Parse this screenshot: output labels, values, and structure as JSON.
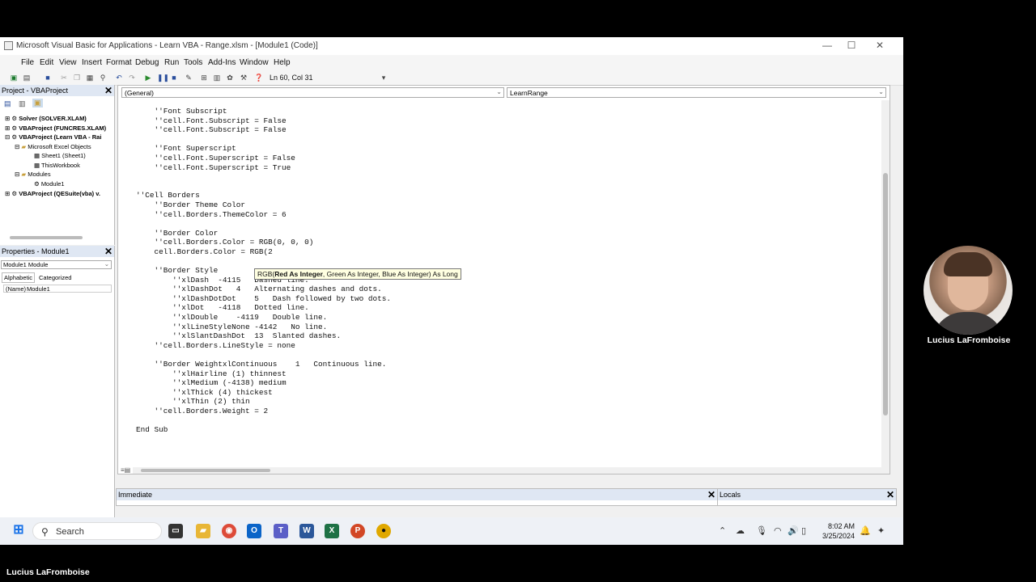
{
  "window": {
    "title": "Microsoft Visual Basic for Applications - Learn VBA - Range.xlsm - [Module1 (Code)]",
    "minimize": "—",
    "maximize": "☐",
    "close": "✕"
  },
  "menu": [
    "File",
    "Edit",
    "View",
    "Insert",
    "Format",
    "Debug",
    "Run",
    "Tools",
    "Add-Ins",
    "Window",
    "Help"
  ],
  "toolbar": {
    "position": "Ln 60, Col 31"
  },
  "project": {
    "title": "Project - VBAProject",
    "items": [
      {
        "label": "Solver (SOLVER.XLAM)",
        "bold": true
      },
      {
        "label": "VBAProject (FUNCRES.XLAM)",
        "bold": true
      },
      {
        "label": "VBAProject (Learn VBA - Rai",
        "bold": true
      },
      {
        "label": "Microsoft Excel Objects",
        "bold": false
      },
      {
        "label": "Sheet1 (Sheet1)",
        "bold": false
      },
      {
        "label": "ThisWorkbook",
        "bold": false
      },
      {
        "label": "Modules",
        "bold": false
      },
      {
        "label": "Module1",
        "bold": false
      },
      {
        "label": "VBAProject (QESuite(vba) v.",
        "bold": true
      }
    ]
  },
  "properties": {
    "title": "Properties - Module1",
    "object": "Module1 Module",
    "tabs": [
      "Alphabetic",
      "Categorized"
    ],
    "row_name": "(Name)",
    "row_value": "Module1"
  },
  "code_window": {
    "general": "(General)",
    "proc": "LearnRange",
    "code": "    ''Font Subscript\n    ''cell.Font.Subscript = False\n    ''cell.Font.Subscript = False\n\n    ''Font Superscript\n    ''cell.Font.Superscript = False\n    ''cell.Font.Superscript = True\n\n\n''Cell Borders\n    ''Border Theme Color\n    ''cell.Borders.ThemeColor = 6\n\n    ''Border Color\n    ''cell.Borders.Color = RGB(0, 0, 0)\n    cell.Borders.Color = RGB(2\n\n    ''Border Style\n        ''xlDash  -4115   Dashed line.\n        ''xlDashDot   4   Alternating dashes and dots.\n        ''xlDashDotDot    5   Dash followed by two dots.\n        ''xlDot   -4118   Dotted line.\n        ''xlDouble    -4119   Double line.\n        ''xlLineStyleNone -4142   No line.\n        ''xlSlantDashDot  13  Slanted dashes.\n    ''cell.Borders.LineStyle = none\n\n    ''Border WeightxlContinuous    1   Continuous line.\n        ''xlHairline (1) thinnest\n        ''xlMedium (-4138) medium\n        ''xlThick (4) thickest\n        ''xlThin (2) thin\n    ''cell.Borders.Weight = 2\n\nEnd Sub",
    "tooltip_func": "RGB(",
    "tooltip_bold": "Red As Integer",
    "tooltip_rest": ", Green As Integer, Blue As Integer) As Long"
  },
  "immediate": {
    "title": "Immediate"
  },
  "locals": {
    "title": "Locals"
  },
  "taskbar": {
    "search": "Search",
    "time": "8:02 AM",
    "date": "3/25/2024"
  },
  "webcam": {
    "name": "Lucius LaFromboise"
  },
  "footer_name": "Lucius LaFromboise"
}
